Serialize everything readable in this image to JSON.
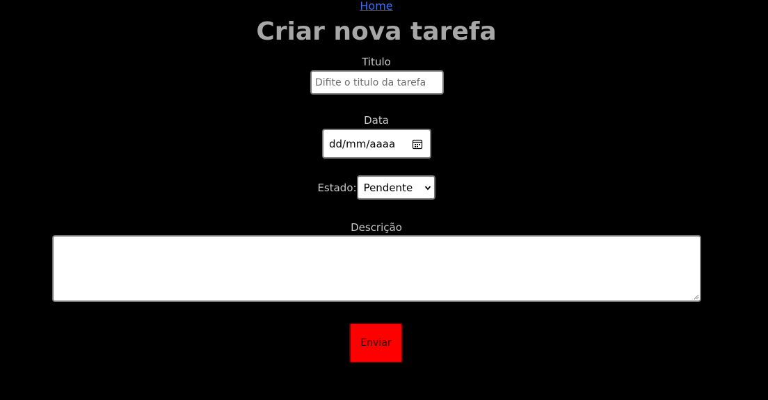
{
  "nav": {
    "home_label": "Home"
  },
  "page_title": "Criar nova tarefa",
  "form": {
    "title_label": "Titulo",
    "title_placeholder": "Difite o titulo da tarefa",
    "date_label": "Data",
    "date_value": "dd/mm/aaaa",
    "date_icon": "calendar-icon",
    "status_label": "Estado:",
    "status_selected": "Pendente",
    "description_label": "Descrição",
    "description_value": "",
    "submit_label": "Enviar"
  },
  "colors": {
    "background": "#000000",
    "link": "#3b6cff",
    "title": "#a7a7a7",
    "label": "#c9c9c9",
    "submit_bg": "#ff0000"
  }
}
